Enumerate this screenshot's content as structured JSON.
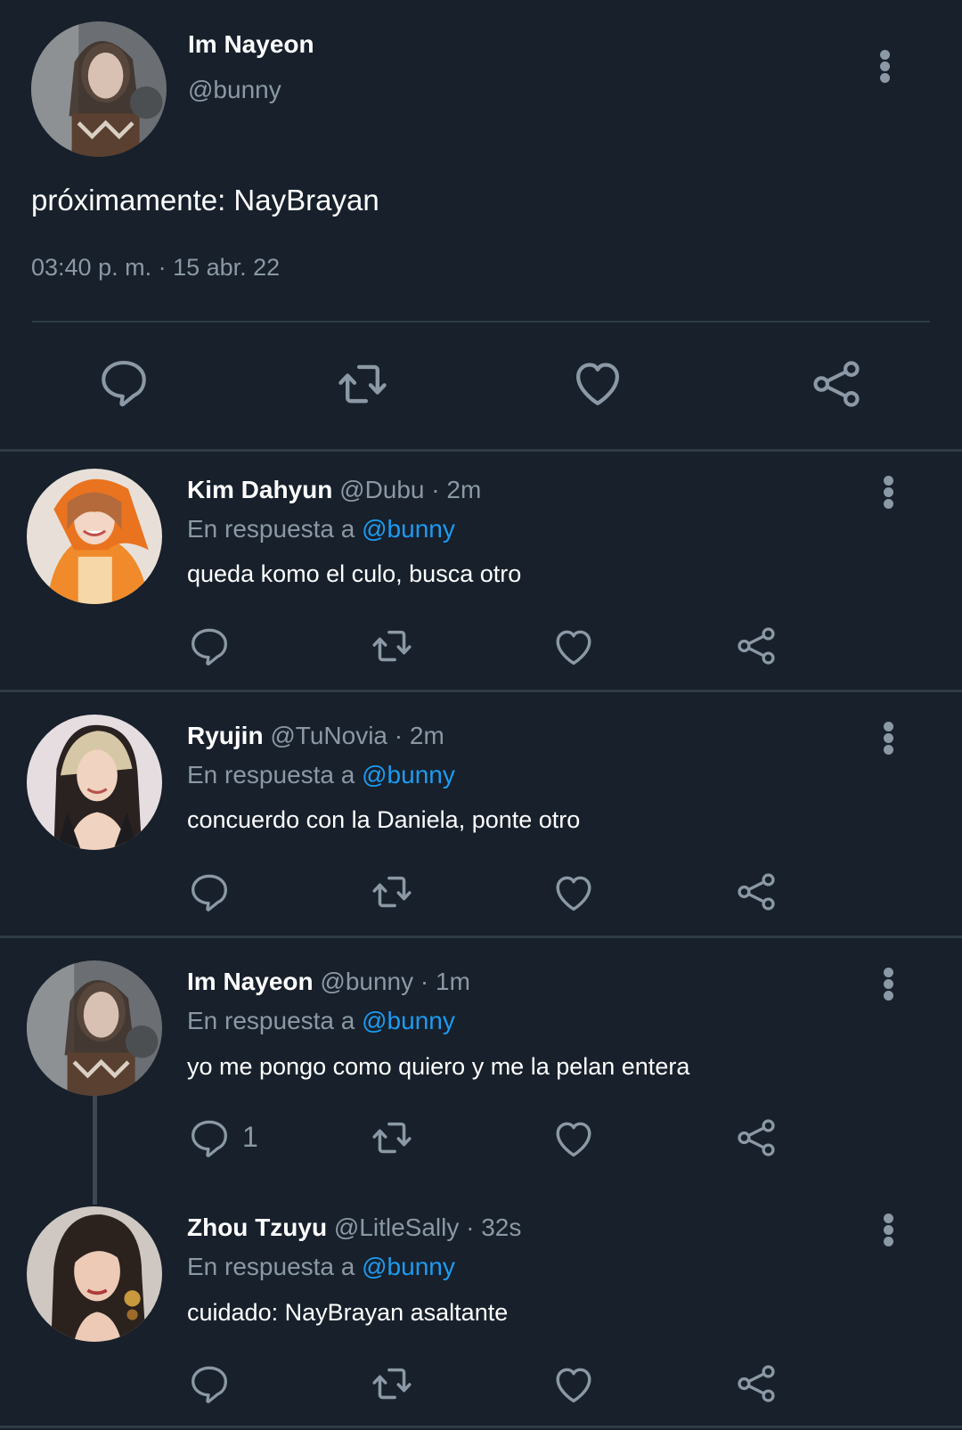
{
  "main_tweet": {
    "display_name": "Im Nayeon",
    "handle": "@bunny",
    "text": "próximamente: NayBrayan",
    "timestamp": "03:40 p. m. · 15 abr. 22"
  },
  "reply_label": "En respuesta a",
  "reply_to": "@bunny",
  "replies": [
    {
      "display_name": "Kim Dahyun",
      "handle": "@Dubu",
      "time": "· 2m",
      "text": "queda komo el culo, busca otro",
      "reply_count": ""
    },
    {
      "display_name": "Ryujin",
      "handle": "@TuNovia",
      "time": "· 2m",
      "text": "concuerdo con la Daniela, ponte otro",
      "reply_count": ""
    },
    {
      "display_name": "Im Nayeon",
      "handle": "@bunny",
      "time": "· 1m",
      "text": "yo me pongo como quiero y me la pelan entera",
      "reply_count": "1"
    },
    {
      "display_name": "Zhou Tzuyu",
      "handle": "@LitleSally",
      "time": "· 32s",
      "text": "cuidado: NayBrayan asaltante",
      "reply_count": ""
    }
  ],
  "icons": {
    "reply": "reply-icon",
    "retweet": "retweet-icon",
    "like": "heart-icon",
    "share": "share-icon",
    "more": "more-vertical-icon"
  },
  "colors": {
    "background": "#17202b",
    "muted": "#8b98a5",
    "link": "#1d9bf0",
    "divider": "#2f3b47"
  }
}
